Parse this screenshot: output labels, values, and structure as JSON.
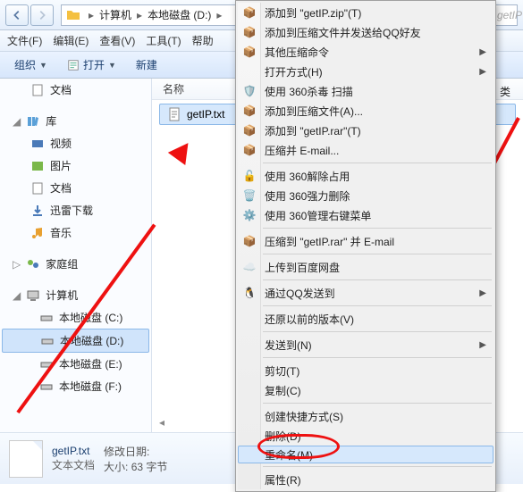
{
  "nav": {
    "crumb1": "计算机",
    "crumb2": "本地磁盘 (D:)",
    "right_hint": "getIP"
  },
  "menubar": {
    "file": "文件(F)",
    "edit": "编辑(E)",
    "view": "查看(V)",
    "tools": "工具(T)",
    "help": "帮助"
  },
  "toolbar": {
    "organize": "组织",
    "open": "打开",
    "new": "新建"
  },
  "sidebar": {
    "docs": "文档",
    "library": "库",
    "video": "视频",
    "pictures": "图片",
    "docs2": "文档",
    "xunlei": "迅雷下载",
    "music": "音乐",
    "homegroup": "家庭组",
    "computer": "计算机",
    "driveC": "本地磁盘 (C:)",
    "driveD": "本地磁盘 (D:)",
    "driveE": "本地磁盘 (E:)",
    "driveF": "本地磁盘 (F:)"
  },
  "content": {
    "col_name": "名称",
    "file1": "getIP.txt",
    "partial_side": "类"
  },
  "details": {
    "filename": "getIP.txt",
    "filetype": "文本文档",
    "mod_label": "修改日期:",
    "mod_value": "",
    "size_label": "大小:",
    "size_value": "63 字节"
  },
  "ctx": {
    "i1": "添加到 \"getIP.zip\"(T)",
    "i2": "添加到压缩文件并发送给QQ好友",
    "i3": "其他压缩命令",
    "i4": "打开方式(H)",
    "i5": "使用 360杀毒 扫描",
    "i6": "添加到压缩文件(A)...",
    "i7": "添加到 \"getIP.rar\"(T)",
    "i8": "压缩并 E-mail...",
    "i9": "使用 360解除占用",
    "i10": "使用 360强力删除",
    "i11": "使用 360管理右键菜单",
    "i12": "压缩到 \"getIP.rar\" 并 E-mail",
    "i13": "上传到百度网盘",
    "i14": "通过QQ发送到",
    "i15": "还原以前的版本(V)",
    "i16": "发送到(N)",
    "i17": "剪切(T)",
    "i18": "复制(C)",
    "i19": "创建快捷方式(S)",
    "i20": "删除(D)",
    "i21": "重命名(M)",
    "i22": "属性(R)"
  }
}
